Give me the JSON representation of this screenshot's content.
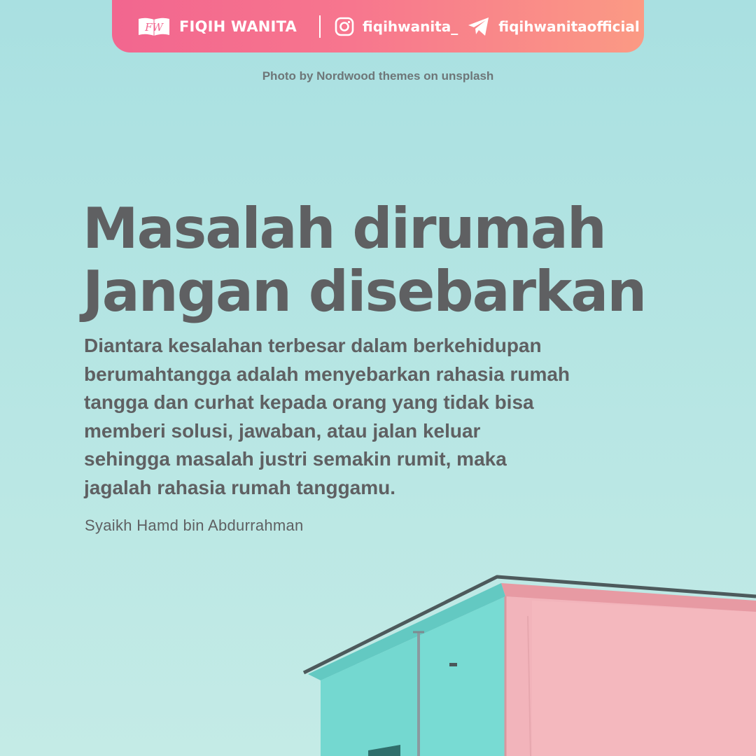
{
  "header": {
    "brand_name": "FIQIH WANITA",
    "logo_monogram": "FW",
    "instagram_handle": "fiqihwanita_",
    "telegram_handle": "fiqihwanitaofficial",
    "icons": {
      "brand": "open-book-logo-icon",
      "instagram": "instagram-icon",
      "telegram": "telegram-icon"
    }
  },
  "photo_credit": "Photo by Nordwood themes on unsplash",
  "title_lines": [
    "Masalah dirumah",
    "Jangan disebarkan"
  ],
  "body_lines": [
    "Diantara kesalahan terbesar dalam berkehidupan",
    "berumahtangga adalah menyebarkan rahasia rumah",
    "tangga dan curhat kepada orang yang tidak bisa",
    "memberi solusi, jawaban, atau jalan keluar",
    "sehingga masalah justri semakin rumit, maka",
    "jagalah rahasia rumah tanggamu."
  ],
  "attribution": "Syaikh Hamd bin Abdurrahman",
  "colors": {
    "header_gradient_start": "#f2668f",
    "header_gradient_end": "#fb9a84",
    "text_gray": "#5f6062",
    "sky": "#b5e5e3",
    "building_teal": "#76d9d2",
    "building_pink": "#f2b3ba"
  }
}
